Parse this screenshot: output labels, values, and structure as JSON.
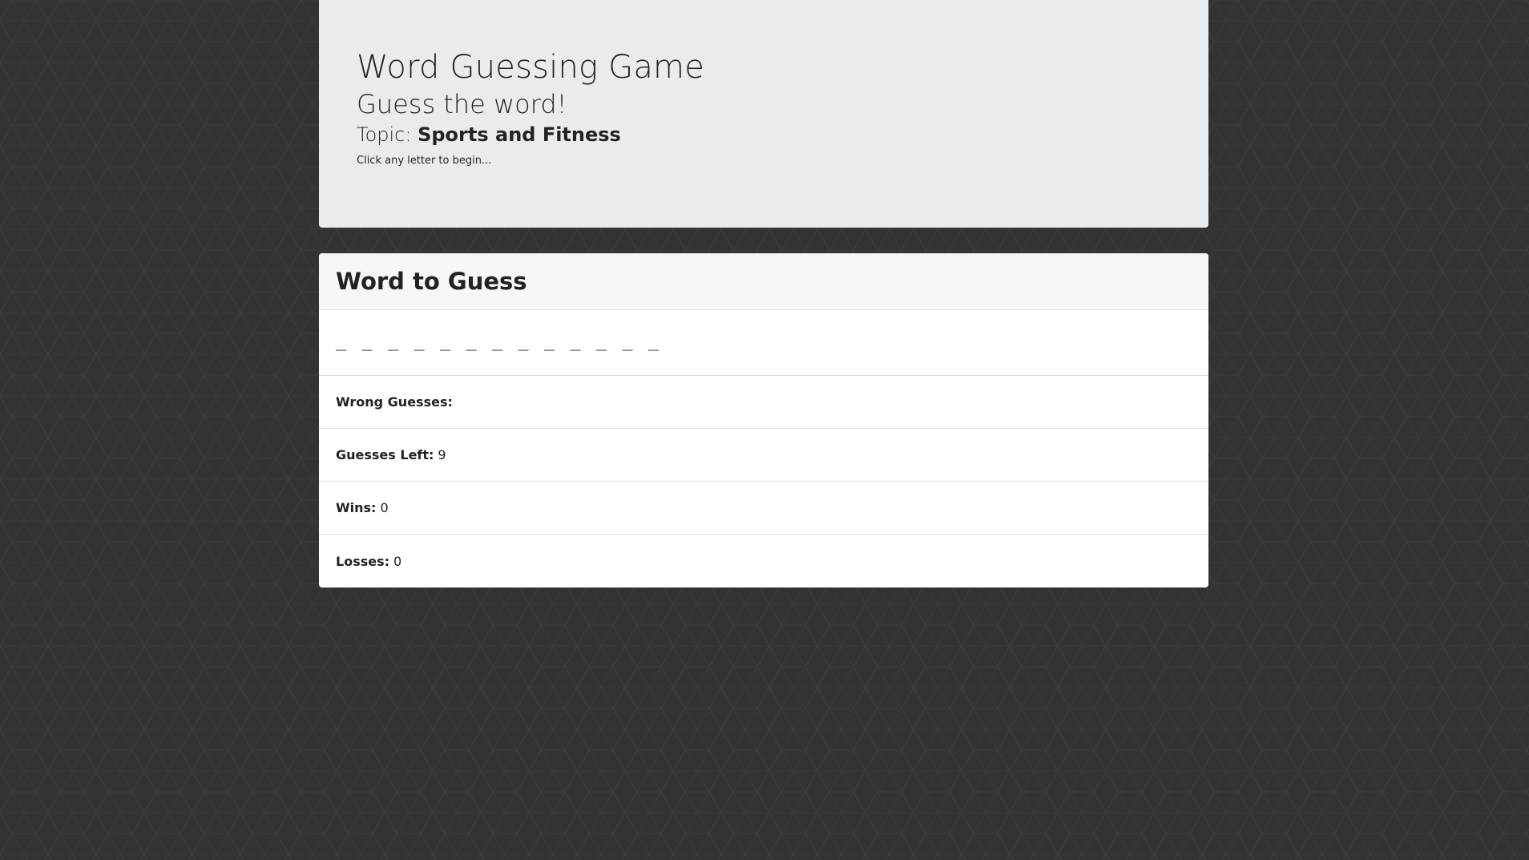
{
  "header": {
    "title": "Word Guessing Game",
    "subtitle": "Guess the word!",
    "topic_label": "Topic:",
    "topic_value": "Sports and Fitness",
    "hint": "Click any letter to begin..."
  },
  "card": {
    "title": "Word to Guess",
    "word_display": "_ _ _ _ _ _ _ _ _ _ _ _ _",
    "stats": [
      {
        "label": "Wrong Guesses:",
        "value": ""
      },
      {
        "label": "Guesses Left:",
        "value": "9"
      },
      {
        "label": "Wins:",
        "value": "0"
      },
      {
        "label": "Losses:",
        "value": "0"
      }
    ]
  },
  "colors": {
    "background": "#333333",
    "jumbotron": "#e9ecef",
    "card_header": "#f7f7f7",
    "text": "#222222"
  }
}
